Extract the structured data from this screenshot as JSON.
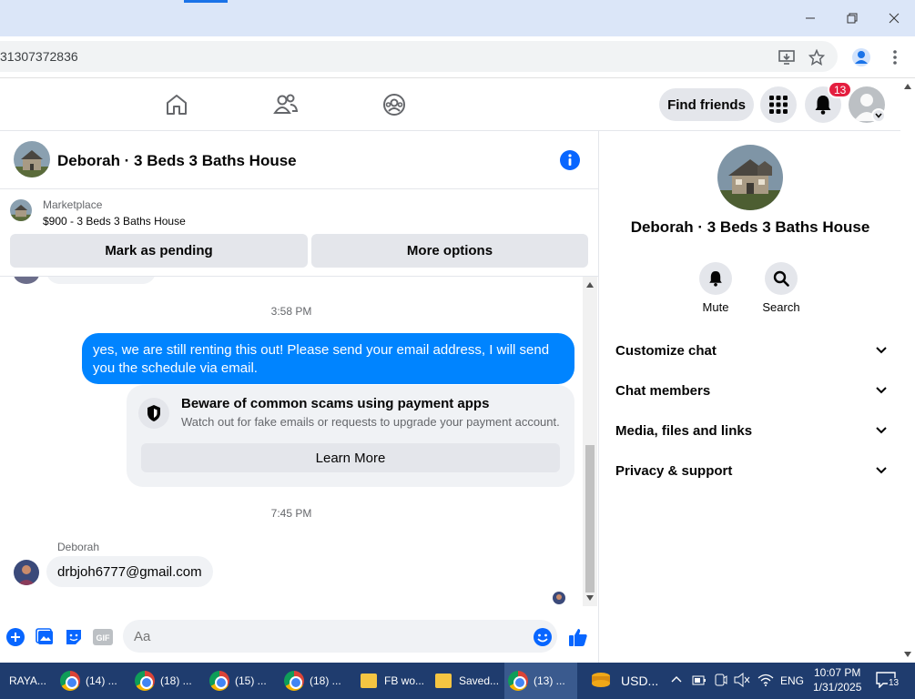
{
  "browser": {
    "url_fragment": "31307372836"
  },
  "nav": {
    "find_friends": "Find friends",
    "notification_count": "13"
  },
  "chat": {
    "title": "Deborah · 3 Beds 3 Baths House",
    "marketplace_label": "Marketplace",
    "listing": "$900 - 3 Beds 3 Baths House",
    "mark_pending": "Mark as pending",
    "more_options": "More options",
    "time1": "3:58 PM",
    "outgoing_message": "yes, we are still renting this out! Please send your email address, I will send you the schedule via email.",
    "scam_title": "Beware of common scams using payment apps",
    "scam_desc": "Watch out for fake emails or requests to upgrade your payment account.",
    "learn_more": "Learn More",
    "time2": "7:45 PM",
    "sender": "Deborah",
    "incoming_message": "drbjoh6777@gmail.com",
    "composer_placeholder": "Aa"
  },
  "info": {
    "name": "Deborah · 3 Beds 3 Baths House",
    "mute": "Mute",
    "search": "Search",
    "sections": [
      "Customize chat",
      "Chat members",
      "Media, files and links",
      "Privacy & support"
    ]
  },
  "taskbar": {
    "items": [
      "RAYA...",
      "(14) ...",
      "(18) ...",
      "(15) ...",
      "(18) ...",
      "FB wo...",
      "Saved...",
      "(13) ..."
    ],
    "currency": "USD...",
    "lang": "ENG",
    "time": "10:07 PM",
    "date": "1/31/2025",
    "notif_count": "13"
  },
  "colors": {
    "messenger_blue": "#0084ff",
    "fb_blue": "#0866ff",
    "badge_red": "#e41e3f"
  }
}
